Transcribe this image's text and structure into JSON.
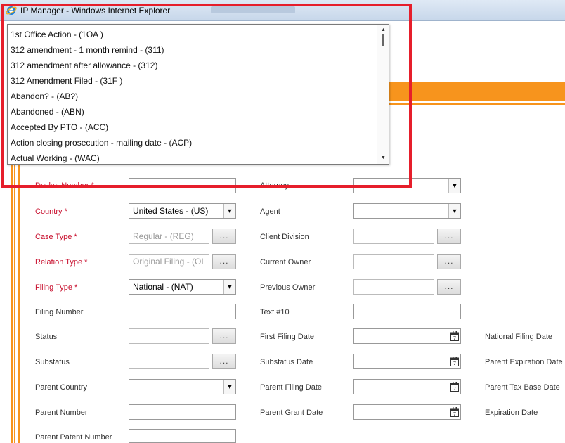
{
  "window": {
    "title": "IP Manager - Windows Internet Explorer"
  },
  "colors": {
    "accent": "#f7941d",
    "required": "#c8102e",
    "highlight": "#e61e2b"
  },
  "dropdown": {
    "items": [
      "1st Office Action - (1OA )",
      "312 amendment - 1 month remind - (311)",
      "312 amendment after allowance - (312)",
      "312 Amendment Filed - (31F )",
      "Abandon? - (AB?)",
      "Abandoned - (ABN)",
      "Accepted By PTO - (ACC)",
      "Action closing prosecution - mailing date - (ACP)",
      "Actual Working - (WAC)"
    ]
  },
  "form": {
    "docket_number": {
      "label": "Docket Number *"
    },
    "attorney": {
      "label": "Attorney"
    },
    "country": {
      "label": "Country *",
      "value": "United States - (US)"
    },
    "agent": {
      "label": "Agent"
    },
    "case_type": {
      "label": "Case Type *",
      "value": "Regular - (REG)"
    },
    "client_division": {
      "label": "Client Division"
    },
    "relation_type": {
      "label": "Relation Type *",
      "value": "Original Filing - (OI"
    },
    "current_owner": {
      "label": "Current Owner"
    },
    "filing_type": {
      "label": "Filing Type *",
      "value": "National - (NAT)"
    },
    "previous_owner": {
      "label": "Previous Owner"
    },
    "filing_number": {
      "label": "Filing Number"
    },
    "text10": {
      "label": "Text #10"
    },
    "status": {
      "label": "Status"
    },
    "first_filing_date": {
      "label": "First Filing Date"
    },
    "national_filing_date": {
      "label": "National Filing Date"
    },
    "substatus": {
      "label": "Substatus"
    },
    "substatus_date": {
      "label": "Substatus Date"
    },
    "parent_expiration_date": {
      "label": "Parent Expiration Date"
    },
    "parent_country": {
      "label": "Parent Country"
    },
    "parent_filing_date": {
      "label": "Parent Filing Date"
    },
    "parent_tax_base_date": {
      "label": "Parent Tax Base Date"
    },
    "parent_number": {
      "label": "Parent Number"
    },
    "parent_grant_date": {
      "label": "Parent Grant Date"
    },
    "expiration_date": {
      "label": "Expiration Date"
    },
    "parent_patent_number": {
      "label": "Parent Patent Number"
    }
  },
  "buttons": {
    "browse": "..."
  }
}
